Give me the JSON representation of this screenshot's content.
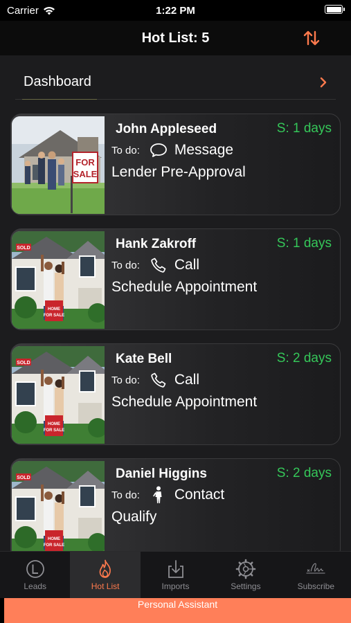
{
  "status_bar": {
    "carrier": "Carrier",
    "time": "1:22 PM"
  },
  "nav": {
    "title": "Hot List: 5",
    "sort_icon": "sort-arrows-icon"
  },
  "dashboard": {
    "label": "Dashboard"
  },
  "todo_label": "To do:",
  "cards": [
    {
      "name": "John Appleseed",
      "stage": "S: 1 days",
      "action": "Message",
      "action_icon": "message-bubble-icon",
      "task": "Lender Pre-Approval",
      "photo": "family-for-sale-photo"
    },
    {
      "name": "Hank Zakroff",
      "stage": "S: 1 days",
      "action": "Call",
      "action_icon": "phone-icon",
      "task": "Schedule Appointment",
      "photo": "sold-house-photo"
    },
    {
      "name": "Kate Bell",
      "stage": "S: 2 days",
      "action": "Call",
      "action_icon": "phone-icon",
      "task": "Schedule Appointment",
      "photo": "sold-house-photo"
    },
    {
      "name": "Daniel Higgins",
      "stage": "S: 2 days",
      "action": "Contact",
      "action_icon": "person-icon",
      "task": "Qualify",
      "photo": "sold-house-photo"
    }
  ],
  "tabs": [
    {
      "label": "Leads",
      "icon": "leads-circle-icon",
      "active": false
    },
    {
      "label": "Hot List",
      "icon": "flame-icon",
      "active": true
    },
    {
      "label": "Imports",
      "icon": "import-tray-icon",
      "active": false
    },
    {
      "label": "Settings",
      "icon": "gear-icon",
      "active": false
    },
    {
      "label": "Subscribe",
      "icon": "signature-icon",
      "active": false
    }
  ],
  "assistant": {
    "label": "Personal Assistant"
  },
  "colors": {
    "accent": "#ff7a4d",
    "stage_green": "#35c759",
    "assistant_bar": "#ff7f59",
    "background": "#1c1c1e"
  }
}
